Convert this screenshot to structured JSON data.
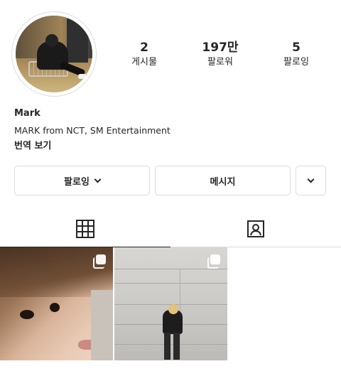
{
  "profile": {
    "username": "Mark",
    "bio": "MARK from NCT, SM Entertainment",
    "translate_label": "번역 보기"
  },
  "stats": [
    {
      "value": "2",
      "label": "게시물"
    },
    {
      "value": "197만",
      "label": "팔로워"
    },
    {
      "value": "5",
      "label": "팔로잉"
    }
  ],
  "buttons": {
    "follow_label": "팔로잉",
    "message_label": "메시지"
  },
  "tabs": [
    {
      "icon": "grid-icon",
      "active": true
    },
    {
      "icon": "tagged-icon",
      "active": false
    }
  ],
  "posts": [
    {
      "icon": "multiple-photos-icon"
    },
    {
      "icon": "multiple-photos-icon"
    }
  ],
  "colors": {
    "text": "#262626",
    "border": "#dbdbdb",
    "background": "#ffffff"
  }
}
